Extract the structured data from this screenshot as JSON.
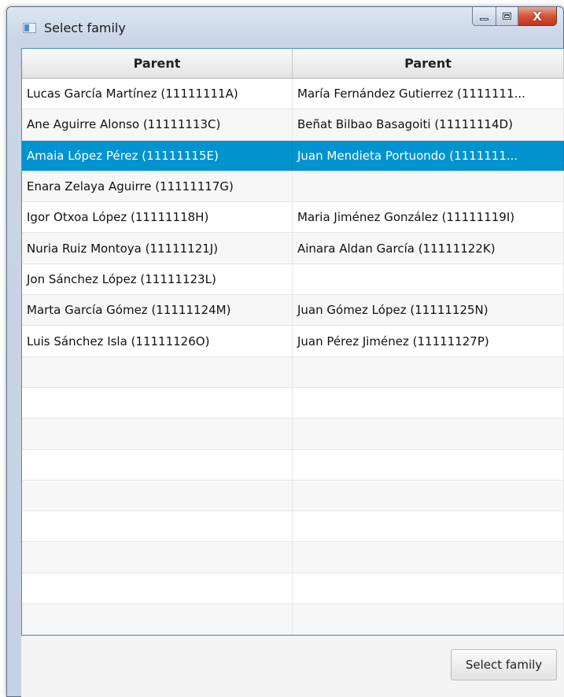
{
  "window": {
    "title": "Select family",
    "minimize_label": "",
    "maximize_label": "",
    "close_glyph": "X"
  },
  "table": {
    "columns": [
      "Parent",
      "Parent"
    ],
    "rows": [
      [
        "Lucas García Martínez (11111111A)",
        "María Fernández Gutierrez (1111111..."
      ],
      [
        "Ane Aguirre Alonso (11111113C)",
        "Beñat Bilbao Basagoiti (11111114D)"
      ],
      [
        "Amaia López Pérez (11111115E)",
        "Juan Mendieta Portuondo (1111111..."
      ],
      [
        "Enara Zelaya Aguirre (11111117G)",
        ""
      ],
      [
        "Igor Otxoa López (11111118H)",
        "Maria Jiménez González (11111119I)"
      ],
      [
        "Nuria Ruiz Montoya (11111121J)",
        "Ainara Aldan García (11111122K)"
      ],
      [
        "Jon Sánchez López (11111123L)",
        ""
      ],
      [
        "Marta García Gómez (11111124M)",
        "Juan Gómez López (11111125N)"
      ],
      [
        "Luis Sánchez Isla (11111126O)",
        "Juan Pérez Jiménez (11111127P)"
      ]
    ],
    "selected_row": 2,
    "empty_rows": 9,
    "selection_color": "#0093d0",
    "border_color": "#3d94c8"
  },
  "footer": {
    "select_button_label": "Select family"
  }
}
